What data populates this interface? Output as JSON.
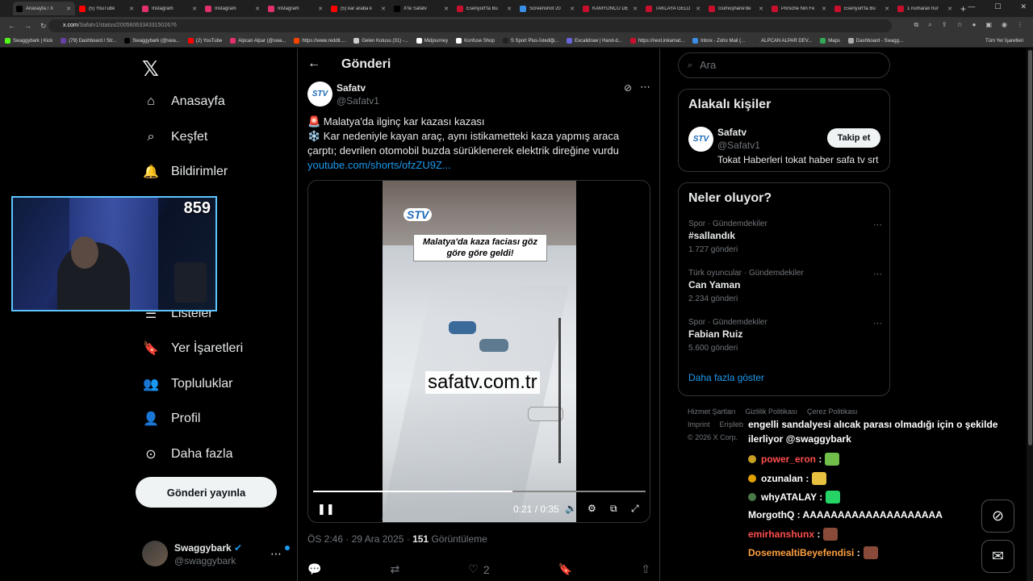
{
  "browser": {
    "tabs": [
      {
        "label": "Anasayfa / X",
        "color": "#000000",
        "active": true
      },
      {
        "label": "(5) YouTube",
        "color": "#ff0000"
      },
      {
        "label": "Instagram",
        "color": "#e1306c"
      },
      {
        "label": "Instagram",
        "color": "#e1306c"
      },
      {
        "label": "Instagram",
        "color": "#e1306c"
      },
      {
        "label": "(5) kar araba k",
        "color": "#ff0000"
      },
      {
        "label": "X'te Safatv",
        "color": "#000000"
      },
      {
        "label": "Esenyurt'ta Bu",
        "color": "#c8102e"
      },
      {
        "label": "Screenshot 20",
        "color": "#3a8ee6"
      },
      {
        "label": "KAMYONCU DE",
        "color": "#c8102e"
      },
      {
        "label": "TAKLAYA GELD",
        "color": "#c8102e"
      },
      {
        "label": "Gümüşhane'de",
        "color": "#c8102e"
      },
      {
        "label": "Porsche Nin Fe",
        "color": "#c8102e"
      },
      {
        "label": "Esenyurt'ta Bu",
        "color": "#c8102e"
      },
      {
        "label": "1 numaralı hur",
        "color": "#c8102e"
      }
    ],
    "url_host": "x.com",
    "url_path": "/Safatv1/status/2005606334331502676",
    "bookmarks": [
      "Swaggybark | Kick",
      "(79) Dashboard / Str...",
      "Swaggybark (@swa...",
      "(2) YouTube",
      "Alpcan Alpar (@swa...",
      "https://www.reddit....",
      "Gelen Kutusu (31) -...",
      "Midjourney",
      "Konfuse Shop",
      "S Sport Plus-İstediği...",
      "Excalidraw | Hand-d...",
      "https://next.inkarnat...",
      "Inbox - Zoho Mail (...",
      "ALPCAN ALPAR DEV...",
      "Maps",
      "Dashboard - Swagg..."
    ],
    "bookmarks_end": "Tüm Yer İşaretleri"
  },
  "nav": {
    "items": [
      {
        "label": "Anasayfa",
        "icon": "home-icon"
      },
      {
        "label": "Keşfet",
        "icon": "search-icon"
      },
      {
        "label": "Bildirimler",
        "icon": "bell-icon"
      },
      {
        "label": "Listeler",
        "icon": "list-icon"
      },
      {
        "label": "Yer İşaretleri",
        "icon": "bookmark-icon"
      },
      {
        "label": "Topluluklar",
        "icon": "communities-icon"
      },
      {
        "label": "Profil",
        "icon": "profile-icon"
      },
      {
        "label": "Daha fazla",
        "icon": "more-circle-icon"
      }
    ],
    "post_button": "Gönderi yayınla",
    "account_name": "Swaggybark",
    "account_handle": "@swaggybark"
  },
  "webcam": {
    "counter": "859"
  },
  "post": {
    "header_title": "Gönderi",
    "author_name": "Safatv",
    "author_handle": "@Safatv1",
    "avatar_text": "STV",
    "line1": "🚨 Malatya'da ilginç kar kazası  kazası",
    "line2": "❄️ Kar nedeniyle kayan araç, aynı istikametteki kaza yapmış araca çarptı; devrilen otomobil buzda sürüklenerek elektrik direğine vurdu",
    "link": "youtube.com/shorts/ofzZU9Z...",
    "video_logo": "STV",
    "video_caption": "Malatya'da kaza faciası göz göre göre geldi!",
    "video_watermark": "safatv.com.tr",
    "time": "0:21 / 0:35",
    "progress": 0.6,
    "meta_time": "ÖS 2:46 · 29 Ara 2025 · ",
    "views": "151",
    "views_label": " Görüntüleme",
    "likes": "2"
  },
  "sidebar": {
    "search_placeholder": "Ara",
    "relevant_title": "Alakalı kişiler",
    "person_name": "Safatv",
    "person_handle": "@Safatv1",
    "person_bio": "Tokat Haberleri tokat haber safa tv srt",
    "follow_label": "Takip et",
    "trends_title": "Neler oluyor?",
    "trends": [
      {
        "category": "Spor · Gündemdekiler",
        "title": "#sallandık",
        "count": "1.727 gönderi"
      },
      {
        "category": "Türk oyuncular · Gündemdekiler",
        "title": "Can Yaman",
        "count": "2.234 gönderi"
      },
      {
        "category": "Spor · Gündemdekiler",
        "title": "Fabian Ruiz",
        "count": "5.600 gönderi"
      }
    ],
    "show_more": "Daha fazla göster",
    "footer_links": [
      "Hizmet Şartları",
      "Gizlilik Politikası",
      "Çerez Politikası",
      "Imprint",
      "Erişileb"
    ],
    "copyright": "© 2026 X Corp."
  },
  "chat": {
    "message": "engelli sandalyesi alıcak parası olmadığı için o şekilde ilerliyor @swaggybark",
    "lines": [
      {
        "user": "power_eron",
        "color": "#ff4d4d",
        "text": " :",
        "badge": "#c8a020",
        "emote": "#6fbf4a"
      },
      {
        "user": "ozunalan",
        "color": "#ffffff",
        "text": " :",
        "badge": "#e0a000",
        "emote": "#e8c040"
      },
      {
        "user": "whyATALAY",
        "color": "#ffffff",
        "text": " :",
        "badge": "#4a7a4a",
        "emote": "#25d366"
      },
      {
        "user": "MorgothQ",
        "color": "#ffffff",
        "text": " : AAAAAAAAAAAAAAAAAAAA",
        "badge": "",
        "emote": ""
      },
      {
        "user": "emirhanshunx",
        "color": "#ff4d4d",
        "text": " :",
        "badge": "",
        "emote": "#8a4a3a"
      },
      {
        "user": "DosemealtiBeyefendisi",
        "color": "#ffa040",
        "text": " :",
        "badge": "",
        "emote": "#8a4a3a"
      }
    ]
  }
}
